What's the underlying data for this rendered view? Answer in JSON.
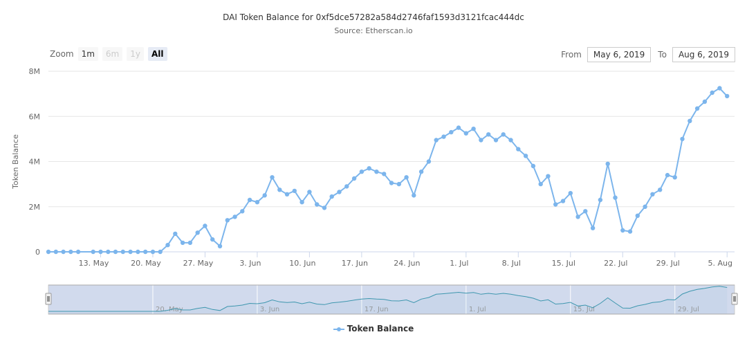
{
  "chart_data": {
    "type": "line",
    "title": "DAI Token Balance for 0xf5dce57282a584d2746faf1593d3121fcac444dc",
    "subtitle": "Source: Etherscan.io",
    "ylabel": "Token Balance",
    "xlabel": "",
    "ylim": [
      0,
      8000000
    ],
    "xlim": [
      "2019-05-06",
      "2019-08-06"
    ],
    "y_ticks": [
      {
        "value": 0,
        "label": "0"
      },
      {
        "value": 2000000,
        "label": "2M"
      },
      {
        "value": 4000000,
        "label": "4M"
      },
      {
        "value": 6000000,
        "label": "6M"
      },
      {
        "value": 8000000,
        "label": "8M"
      }
    ],
    "x_ticks": [
      {
        "date": "2019-05-13",
        "label": "13. May"
      },
      {
        "date": "2019-05-20",
        "label": "20. May"
      },
      {
        "date": "2019-05-27",
        "label": "27. May"
      },
      {
        "date": "2019-06-03",
        "label": "3. Jun"
      },
      {
        "date": "2019-06-10",
        "label": "10. Jun"
      },
      {
        "date": "2019-06-17",
        "label": "17. Jun"
      },
      {
        "date": "2019-06-24",
        "label": "24. Jun"
      },
      {
        "date": "2019-07-01",
        "label": "1. Jul"
      },
      {
        "date": "2019-07-08",
        "label": "8. Jul"
      },
      {
        "date": "2019-07-15",
        "label": "15. Jul"
      },
      {
        "date": "2019-07-22",
        "label": "22. Jul"
      },
      {
        "date": "2019-07-29",
        "label": "29. Jul"
      },
      {
        "date": "2019-08-05",
        "label": "5. Aug"
      }
    ],
    "navigator_ticks": [
      {
        "date": "2019-05-20",
        "label": "20. May"
      },
      {
        "date": "2019-06-03",
        "label": "3. Jun"
      },
      {
        "date": "2019-06-17",
        "label": "17. Jun"
      },
      {
        "date": "2019-07-01",
        "label": "1. Jul"
      },
      {
        "date": "2019-07-15",
        "label": "15. Jul"
      },
      {
        "date": "2019-07-29",
        "label": "29. Jul"
      }
    ],
    "grid": true,
    "legend": "bottom-center",
    "color": "#7cb5ec",
    "series": [
      {
        "name": "Token Balance",
        "points": [
          [
            "2019-05-06",
            0
          ],
          [
            "2019-05-07",
            0
          ],
          [
            "2019-05-08",
            0
          ],
          [
            "2019-05-09",
            0
          ],
          [
            "2019-05-10",
            0
          ],
          [
            "2019-05-12",
            0
          ],
          [
            "2019-05-13",
            0
          ],
          [
            "2019-05-14",
            0
          ],
          [
            "2019-05-15",
            0
          ],
          [
            "2019-05-16",
            0
          ],
          [
            "2019-05-17",
            0
          ],
          [
            "2019-05-18",
            0
          ],
          [
            "2019-05-19",
            0
          ],
          [
            "2019-05-20",
            0
          ],
          [
            "2019-05-21",
            0
          ],
          [
            "2019-05-22",
            300000
          ],
          [
            "2019-05-23",
            800000
          ],
          [
            "2019-05-24",
            400000
          ],
          [
            "2019-05-25",
            400000
          ],
          [
            "2019-05-26",
            850000
          ],
          [
            "2019-05-27",
            1150000
          ],
          [
            "2019-05-28",
            550000
          ],
          [
            "2019-05-29",
            250000
          ],
          [
            "2019-05-30",
            1400000
          ],
          [
            "2019-05-31",
            1550000
          ],
          [
            "2019-06-01",
            1800000
          ],
          [
            "2019-06-02",
            2300000
          ],
          [
            "2019-06-03",
            2200000
          ],
          [
            "2019-06-04",
            2500000
          ],
          [
            "2019-06-05",
            3300000
          ],
          [
            "2019-06-06",
            2750000
          ],
          [
            "2019-06-07",
            2550000
          ],
          [
            "2019-06-08",
            2700000
          ],
          [
            "2019-06-09",
            2200000
          ],
          [
            "2019-06-10",
            2650000
          ],
          [
            "2019-06-11",
            2100000
          ],
          [
            "2019-06-12",
            1950000
          ],
          [
            "2019-06-13",
            2450000
          ],
          [
            "2019-06-14",
            2650000
          ],
          [
            "2019-06-15",
            2900000
          ],
          [
            "2019-06-16",
            3250000
          ],
          [
            "2019-06-17",
            3550000
          ],
          [
            "2019-06-18",
            3700000
          ],
          [
            "2019-06-19",
            3550000
          ],
          [
            "2019-06-20",
            3450000
          ],
          [
            "2019-06-21",
            3050000
          ],
          [
            "2019-06-22",
            3000000
          ],
          [
            "2019-06-23",
            3300000
          ],
          [
            "2019-06-24",
            2500000
          ],
          [
            "2019-06-25",
            3550000
          ],
          [
            "2019-06-26",
            4000000
          ],
          [
            "2019-06-27",
            4950000
          ],
          [
            "2019-06-28",
            5100000
          ],
          [
            "2019-06-29",
            5300000
          ],
          [
            "2019-06-30",
            5500000
          ],
          [
            "2019-07-01",
            5250000
          ],
          [
            "2019-07-02",
            5450000
          ],
          [
            "2019-07-03",
            4950000
          ],
          [
            "2019-07-04",
            5200000
          ],
          [
            "2019-07-05",
            4950000
          ],
          [
            "2019-07-06",
            5200000
          ],
          [
            "2019-07-07",
            4950000
          ],
          [
            "2019-07-08",
            4550000
          ],
          [
            "2019-07-09",
            4250000
          ],
          [
            "2019-07-10",
            3800000
          ],
          [
            "2019-07-11",
            3000000
          ],
          [
            "2019-07-12",
            3350000
          ],
          [
            "2019-07-13",
            2100000
          ],
          [
            "2019-07-14",
            2250000
          ],
          [
            "2019-07-15",
            2600000
          ],
          [
            "2019-07-16",
            1550000
          ],
          [
            "2019-07-17",
            1800000
          ],
          [
            "2019-07-18",
            1050000
          ],
          [
            "2019-07-19",
            2300000
          ],
          [
            "2019-07-20",
            3900000
          ],
          [
            "2019-07-21",
            2400000
          ],
          [
            "2019-07-22",
            950000
          ],
          [
            "2019-07-23",
            900000
          ],
          [
            "2019-07-24",
            1600000
          ],
          [
            "2019-07-25",
            2000000
          ],
          [
            "2019-07-26",
            2550000
          ],
          [
            "2019-07-27",
            2750000
          ],
          [
            "2019-07-28",
            3400000
          ],
          [
            "2019-07-29",
            3300000
          ],
          [
            "2019-07-30",
            5000000
          ],
          [
            "2019-07-31",
            5800000
          ],
          [
            "2019-08-01",
            6350000
          ],
          [
            "2019-08-02",
            6650000
          ],
          [
            "2019-08-03",
            7050000
          ],
          [
            "2019-08-04",
            7250000
          ],
          [
            "2019-08-05",
            6900000
          ]
        ]
      }
    ]
  },
  "toolbar": {
    "zoom_label": "Zoom",
    "buttons": [
      "1m",
      "6m",
      "1y",
      "All"
    ],
    "active": "All",
    "disabled": [
      "6m",
      "1y"
    ],
    "from_label": "From",
    "from_value": "May 6, 2019",
    "to_label": "To",
    "to_value": "Aug 6, 2019"
  }
}
